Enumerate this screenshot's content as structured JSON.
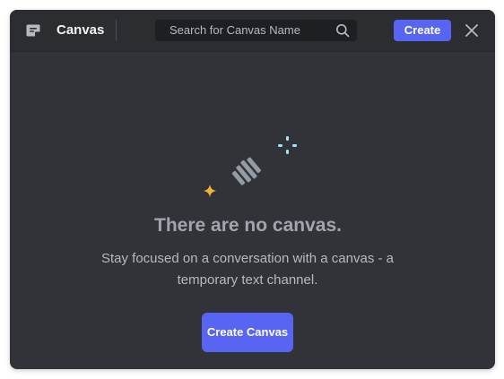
{
  "header": {
    "title": "Canvas",
    "search_placeholder": "Search for Canvas Name",
    "create_label": "Create",
    "icons": {
      "app": "canvas-icon",
      "search": "search-icon",
      "close": "close-icon"
    }
  },
  "empty_state": {
    "title": "There are no canvas.",
    "description": "Stay focused on a conversation with a canvas - a temporary text channel.",
    "button_label": "Create Canvas",
    "illustration": "canvas-sparkles-illustration"
  },
  "colors": {
    "accent": "#5865f2",
    "panel_bg": "#313338",
    "header_bg": "#2b2d31",
    "sparkle_yellow": "#f0b232",
    "sparkle_cyan": "#9ee7f5"
  }
}
